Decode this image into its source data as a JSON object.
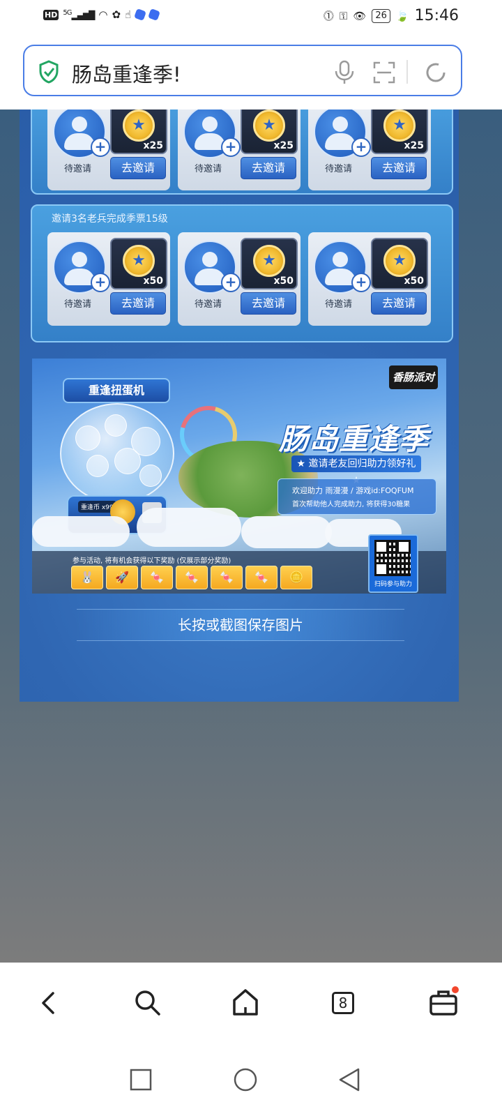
{
  "status_bar": {
    "hd": "HD",
    "signal": "5G",
    "battery": "26",
    "time": "15:46"
  },
  "address_bar": {
    "title": "肠岛重逢季!"
  },
  "task_sections": [
    {
      "title": "",
      "cards": [
        {
          "status": "待邀请",
          "reward_qty": "x25",
          "button": "去邀请"
        },
        {
          "status": "待邀请",
          "reward_qty": "x25",
          "button": "去邀请"
        },
        {
          "status": "待邀请",
          "reward_qty": "x25",
          "button": "去邀请"
        }
      ]
    },
    {
      "title": "邀请3名老兵完成季票15级",
      "cards": [
        {
          "status": "待邀请",
          "reward_qty": "x50",
          "button": "去邀请"
        },
        {
          "status": "待邀请",
          "reward_qty": "x50",
          "button": "去邀请"
        },
        {
          "status": "待邀请",
          "reward_qty": "x50",
          "button": "去邀请"
        }
      ]
    }
  ],
  "poster": {
    "logo": "香肠派对",
    "gacha_title": "重逢扭蛋机",
    "gacha_coin": "重逢币 x99",
    "title": "肠岛重逢季",
    "subtitle": "★ 邀请老友回归助力领好礼 ★",
    "info_line1": "欢迎助力 雨漫漫 / 游戏id:FOQFUM",
    "info_line2": "首次帮助他人完成助力, 将获得30糖果",
    "reward_caption": "参与活动, 将有机会获得以下奖励 (仅展示部分奖励)",
    "qr_label": "扫码参与助力",
    "rewards": [
      "🐰",
      "🚀",
      "🍬",
      "🍬",
      "🍬",
      "🍬",
      "🪙"
    ]
  },
  "save_hint": "长按或截图保存图片",
  "toolbar": {
    "tab_count": "8"
  }
}
